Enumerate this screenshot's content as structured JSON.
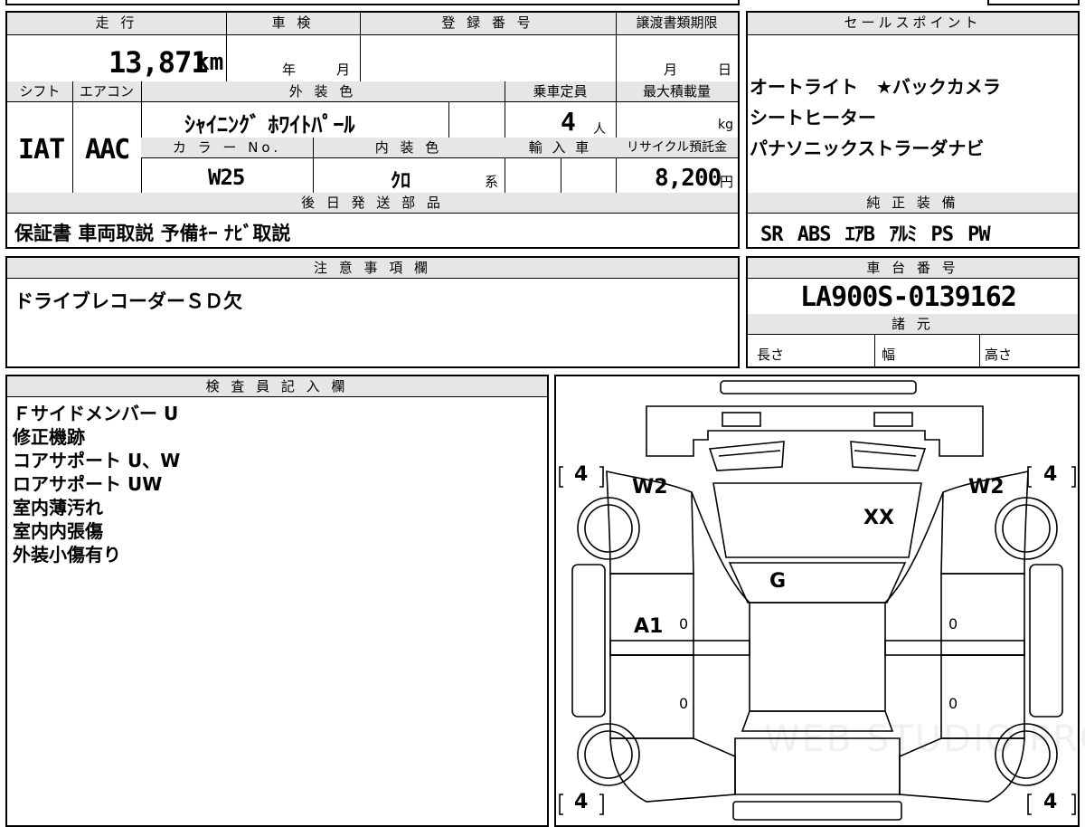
{
  "vehicle": {
    "mileage_header": "走 行",
    "mileage_value": "13,871",
    "mileage_unit": "km",
    "shaken_header": "車 検",
    "shaken_year": "年",
    "shaken_month": "月",
    "reg_header": "登 録 番 号",
    "transfer_header": "譲渡書類期限",
    "transfer_month": "月",
    "transfer_day": "日",
    "shift_header": "シフト",
    "shift_value": "IAT",
    "aircon_header": "エアコン",
    "aircon_value": "AAC",
    "exterior_header": "外 装 色",
    "exterior_value": "ｼｬｲﾆﾝｸﾞ ﾎﾜｲﾄﾊﾟｰﾙ",
    "capacity_header": "乗車定員",
    "capacity_value": "4",
    "capacity_unit": "人",
    "load_header": "最大積載量",
    "load_unit": "kg",
    "color_no_header": "カ ラ ー No.",
    "color_no_value": "W25",
    "interior_header": "内 装 色",
    "interior_value": "ｸﾛ",
    "interior_unit": "系",
    "import_header": "輸 入 車",
    "recycle_header": "リサイクル預託金",
    "recycle_value": "8,200",
    "recycle_unit": "円"
  },
  "later_parts": {
    "header": "後 日 発 送 部 品",
    "value": "保証書 車両取説 予備ｷｰ ﾅﾋﾞ取説"
  },
  "sales_points": {
    "header": "セールスポイント",
    "lines": [
      "オートライト　★バックカメラ",
      "シートヒーター",
      "パナソニックストラーダナビ"
    ]
  },
  "equipment": {
    "header": "純 正 装 備",
    "value": "SR ABS ｴｱB ｱﾙﾐ PS PW"
  },
  "notes": {
    "header": "注 意 事 項 欄",
    "value": "ドライブレコーダーＳＤ欠"
  },
  "chassis": {
    "header": "車 台 番 号",
    "value": "LA900S-0139162",
    "spec_header": "諸 元",
    "length": "長さ",
    "width": "幅",
    "height": "高さ"
  },
  "inspector": {
    "header": "検 査 員 記 入 欄",
    "lines": [
      "Ｆサイドメンバー U",
      "修正機跡",
      "コアサポート U、W",
      "ロアサポート UW",
      "室内薄汚れ",
      "室内内張傷",
      "外装小傷有り"
    ]
  },
  "diagram": {
    "tire_fl": "4",
    "tire_fr": "4",
    "tire_rl": "4",
    "tire_rr": "4",
    "mark_w2_left": "W2",
    "mark_w2_right": "W2",
    "mark_xx": "XX",
    "mark_g": "G",
    "mark_a1": "A1",
    "zero": "0",
    "watermark": "WEB STUDIO PRO"
  }
}
